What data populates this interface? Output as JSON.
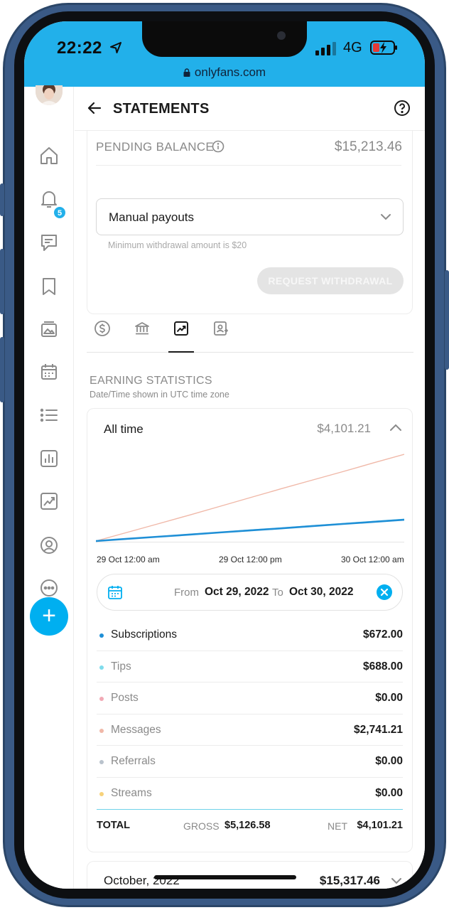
{
  "status_bar": {
    "time": "22:22",
    "network": "4G",
    "url": "onlyfans.com",
    "location_icon": "location-arrow-icon",
    "battery_icon": "battery-charging-icon"
  },
  "colors": {
    "accent": "#00aff0",
    "subscriptions": "#1f8fd6",
    "tips": "#7fdcec",
    "posts": "#f1a9b5",
    "messages": "#f0b8a8",
    "referrals": "#b9c2cc",
    "streams": "#f7d27a"
  },
  "sidebar": {
    "items": [
      {
        "icon": "home-icon"
      },
      {
        "icon": "bell-icon"
      },
      {
        "icon": "messages-icon",
        "badge": "5"
      },
      {
        "icon": "bookmark-icon"
      },
      {
        "icon": "vault-icon"
      },
      {
        "icon": "calendar-icon"
      },
      {
        "icon": "list-icon"
      },
      {
        "icon": "statistics-icon"
      },
      {
        "icon": "statements-icon"
      },
      {
        "icon": "profile-icon"
      },
      {
        "icon": "more-icon"
      }
    ],
    "fab": "+"
  },
  "header": {
    "title": "STATEMENTS"
  },
  "balance": {
    "label": "PENDING BALANCE",
    "amount": "$15,213.46",
    "payout_method": "Manual payouts",
    "min_note": "Minimum withdrawal amount is $20",
    "withdraw_label": "REQUEST WITHDRAWAL"
  },
  "tabs": [
    {
      "icon": "dollar-icon",
      "active": false
    },
    {
      "icon": "bank-icon",
      "active": false
    },
    {
      "icon": "chart-trend-icon",
      "active": true
    },
    {
      "icon": "user-statement-icon",
      "active": false
    }
  ],
  "earnings": {
    "heading": "EARNING STATISTICS",
    "subheading": "Date/Time shown in UTC time zone",
    "range_label": "All time",
    "range_total": "$4,101.21",
    "x_ticks": [
      "29 Oct 12:00 am",
      "29 Oct 12:00 pm",
      "30 Oct 12:00 am"
    ],
    "date_range": {
      "from_label": "From",
      "from": "Oct 29, 2022",
      "to_label": "To",
      "to": "Oct 30, 2022"
    },
    "rows": [
      {
        "label": "Subscriptions",
        "value": "$672.00",
        "color": "#1f8fd6",
        "text_color": "#1a1a1a"
      },
      {
        "label": "Tips",
        "value": "$688.00",
        "color": "#7fdcec",
        "text_color": "#8a8a8a"
      },
      {
        "label": "Posts",
        "value": "$0.00",
        "color": "#f1a9b5",
        "text_color": "#8a8a8a"
      },
      {
        "label": "Messages",
        "value": "$2,741.21",
        "color": "#f0b8a8",
        "text_color": "#8a8a8a"
      },
      {
        "label": "Referrals",
        "value": "$0.00",
        "color": "#b9c2cc",
        "text_color": "#8a8a8a"
      },
      {
        "label": "Streams",
        "value": "$0.00",
        "color": "#f7d27a",
        "text_color": "#8a8a8a"
      }
    ],
    "total": {
      "label": "TOTAL",
      "gross_label": "GROSS",
      "gross": "$5,126.58",
      "net_label": "NET",
      "net": "$4,101.21"
    }
  },
  "chart_data": {
    "type": "line",
    "title": "",
    "xlabel": "",
    "ylabel": "",
    "x_tick_labels": [
      "29 Oct 12:00 am",
      "29 Oct 12:00 pm",
      "30 Oct 12:00 am"
    ],
    "x": [
      0,
      0.1,
      0.2,
      0.3,
      0.4,
      0.5,
      0.6,
      0.7,
      0.8,
      0.9,
      1.0
    ],
    "series": [
      {
        "name": "Messages",
        "color": "#f0b8a8",
        "values": [
          0,
          270,
          540,
          810,
          1090,
          1370,
          1650,
          1920,
          2190,
          2470,
          2741
        ]
      },
      {
        "name": "Tips",
        "color": "#7fdcec",
        "values": [
          0,
          70,
          140,
          210,
          275,
          345,
          410,
          480,
          550,
          620,
          688
        ]
      },
      {
        "name": "Subscriptions",
        "color": "#1f8fd6",
        "values": [
          0,
          70,
          135,
          200,
          270,
          335,
          400,
          470,
          540,
          605,
          672
        ]
      }
    ],
    "ylim": [
      0,
      2741
    ],
    "grid": false,
    "legend": "none"
  },
  "monthly": {
    "label": "October, 2022",
    "value": "$15,317.46"
  }
}
